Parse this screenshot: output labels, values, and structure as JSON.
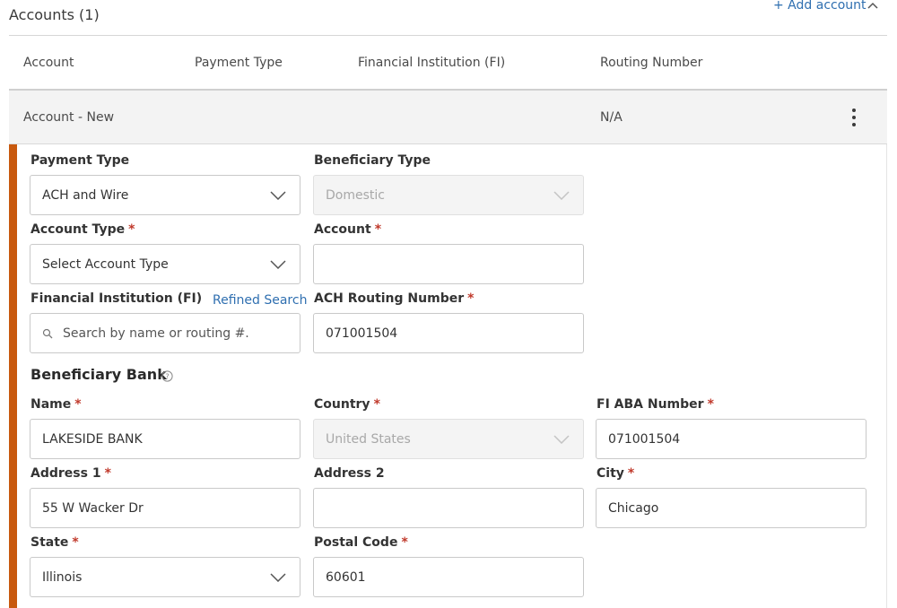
{
  "header": {
    "title": "Accounts (1)",
    "add_label": "+ Add account",
    "collapse_icon": "chevron-up-icon"
  },
  "columns": [
    "Account",
    "Payment Type",
    "Financial Institution (FI)",
    "Routing Number"
  ],
  "account_row": {
    "account": "Account - New",
    "routing": "N/A",
    "menu_icon": "kebab-menu-icon"
  },
  "accent_color": "#c8590e",
  "form": {
    "payment_type": {
      "label": "Payment Type",
      "value": "ACH and Wire"
    },
    "beneficiary_type": {
      "label": "Beneficiary Type",
      "value": "Domestic"
    },
    "account_type": {
      "label": "Account Type",
      "required": "*",
      "value": "Select Account Type"
    },
    "account": {
      "label": "Account",
      "required": "*",
      "value": ""
    },
    "fi": {
      "label": "Financial Institution (FI)",
      "refined_search": "Refined Search",
      "placeholder": "Search by name or routing #."
    },
    "ach_routing": {
      "label": "ACH Routing Number",
      "required": "*",
      "value": "071001504"
    }
  },
  "beneficiary_bank": {
    "title": "Beneficiary Bank",
    "help_icon": "question-circle-icon",
    "name": {
      "label": "Name",
      "required": "*",
      "value": "LAKESIDE BANK"
    },
    "country": {
      "label": "Country",
      "required": "*",
      "value": "United States"
    },
    "fi_aba": {
      "label": "FI ABA Number",
      "required": "*",
      "value": "071001504"
    },
    "address1": {
      "label": "Address 1",
      "required": "*",
      "value": "55 W Wacker Dr"
    },
    "address2": {
      "label": "Address 2",
      "value": ""
    },
    "city": {
      "label": "City",
      "required": "*",
      "value": "Chicago"
    },
    "state": {
      "label": "State",
      "required": "*",
      "value": "Illinois"
    },
    "postal_code": {
      "label": "Postal Code",
      "required": "*",
      "value": "60601"
    }
  }
}
